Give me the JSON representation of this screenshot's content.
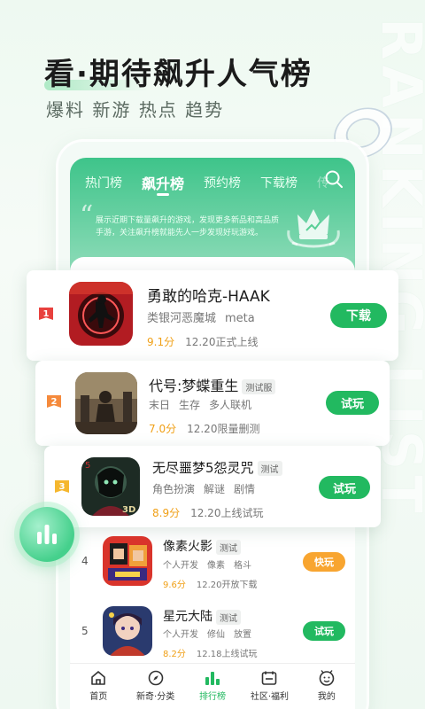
{
  "watermark": "RANKING LIST",
  "hero": {
    "title": "看·期待飙升人气榜",
    "subtitle": "爆料 新游 热点 趋势"
  },
  "tabs": [
    {
      "label": "热门榜",
      "active": false
    },
    {
      "label": "飙升榜",
      "active": true
    },
    {
      "label": "预约榜",
      "active": false
    },
    {
      "label": "下载榜",
      "active": false
    },
    {
      "label": "传",
      "active": false
    }
  ],
  "description": "展示近期下载量飙升的游戏，发现更多新品和高品质手游，关注飙升榜就能先人一步发现好玩游戏。",
  "games": [
    {
      "rank": "1",
      "name": "勇敢的哈克-HAAK",
      "test_badge": "",
      "tags": [
        "类银河恶魔城",
        "meta"
      ],
      "score": "9.1分",
      "status": "12.20正式上线",
      "button": "下载",
      "button_color": "#22b960"
    },
    {
      "rank": "2",
      "name": "代号:梦蝶重生",
      "test_badge": "测试服",
      "tags": [
        "末日",
        "生存",
        "多人联机"
      ],
      "score": "7.0分",
      "status": "12.20限量删测",
      "button": "试玩",
      "button_color": "#22b960"
    },
    {
      "rank": "3",
      "name": "无尽噩梦5怨灵咒",
      "test_badge": "测试",
      "tags": [
        "角色扮演",
        "解谜",
        "剧情"
      ],
      "score": "8.9分",
      "status": "12.20上线试玩",
      "button": "试玩",
      "button_color": "#22b960"
    },
    {
      "rank": "4",
      "name": "像素火影",
      "test_badge": "测试",
      "tags": [
        "个人开发",
        "像素",
        "格斗"
      ],
      "score": "9.6分",
      "status": "12.20开放下载",
      "button": "快玩",
      "button_color": "#f8a530"
    },
    {
      "rank": "5",
      "name": "星元大陆",
      "test_badge": "测试",
      "tags": [
        "个人开发",
        "修仙",
        "放置"
      ],
      "score": "8.2分",
      "status": "12.18上线试玩",
      "button": "试玩",
      "button_color": "#22b960"
    }
  ],
  "nav": [
    {
      "label": "首页",
      "icon": "home-icon",
      "active": false
    },
    {
      "label": "新奇·分类",
      "icon": "compass-icon",
      "active": false
    },
    {
      "label": "排行榜",
      "icon": "ranking-icon",
      "active": true
    },
    {
      "label": "社区·福利",
      "icon": "community-icon",
      "active": false
    },
    {
      "label": "我的",
      "icon": "profile-icon",
      "active": false
    }
  ],
  "colors": {
    "primary": "#22b960",
    "orange": "#f8a530",
    "rank1": "#e8413e",
    "rank2": "#f58a3c",
    "rank3": "#f5b72e"
  }
}
